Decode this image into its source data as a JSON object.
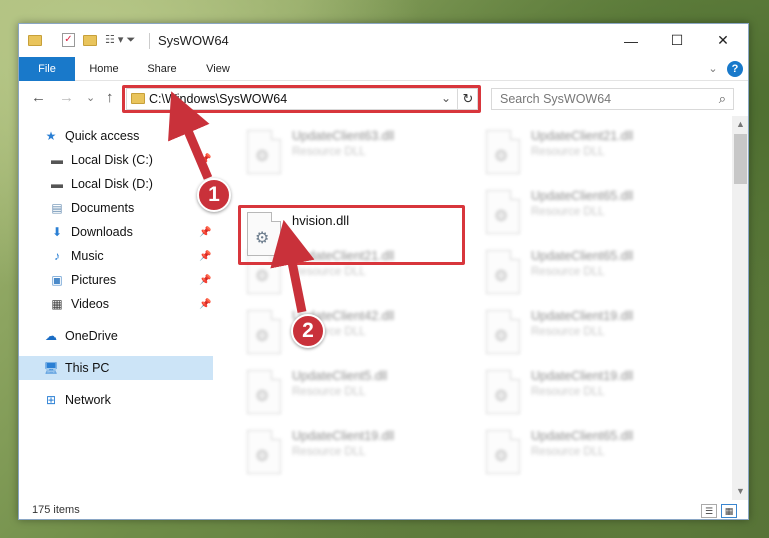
{
  "window": {
    "title": "SysWOW64",
    "minimize_glyph": "—",
    "maximize_glyph": "☐",
    "close_glyph": "✕"
  },
  "ribbon": {
    "tabs": [
      "File",
      "Home",
      "Share",
      "View"
    ],
    "expand_glyph": "⌄",
    "help_glyph": "?"
  },
  "nav": {
    "back": "←",
    "forward": "→",
    "recent": "⌄",
    "up": "↑"
  },
  "address": {
    "path": "C:\\Windows\\SysWOW64",
    "dropdown": "⌄",
    "refresh": "↻"
  },
  "search": {
    "placeholder": "Search SysWOW64",
    "icon": "search-icon"
  },
  "sidebar": {
    "items": [
      {
        "label": "Quick access",
        "icon": "star-icon"
      },
      {
        "label": "Local Disk (C:)",
        "icon": "drive-icon"
      },
      {
        "label": "Local Disk (D:)",
        "icon": "drive-icon"
      },
      {
        "label": "Documents",
        "icon": "documents-icon"
      },
      {
        "label": "Downloads",
        "icon": "downloads-icon"
      },
      {
        "label": "Music",
        "icon": "music-icon"
      },
      {
        "label": "Pictures",
        "icon": "pictures-icon"
      },
      {
        "label": "Videos",
        "icon": "videos-icon"
      },
      {
        "label": "OneDrive",
        "icon": "cloud-icon"
      },
      {
        "label": "This PC",
        "icon": "computer-icon"
      },
      {
        "label": "Network",
        "icon": "network-icon"
      }
    ]
  },
  "files": {
    "highlighted": {
      "name": "hvision.dll"
    },
    "left": [
      {
        "name": "UpdateClient63.dll",
        "type": "Resource DLL"
      },
      {
        "name": "UpdateClient21.dll",
        "type": "Resource DLL"
      },
      {
        "name": "UpdateClient42.dll",
        "type": "Resource DLL"
      },
      {
        "name": "UpdateClient5.dll",
        "type": "Resource DLL"
      },
      {
        "name": "UpdateClient19.dll",
        "type": "Resource DLL"
      }
    ],
    "right": [
      {
        "name": "UpdateClient21.dll",
        "type": "Resource DLL"
      },
      {
        "name": "UpdateClient65.dll",
        "type": "Resource DLL"
      },
      {
        "name": "UpdateClient65.dll",
        "type": "Resource DLL"
      },
      {
        "name": "UpdateClient19.dll",
        "type": "Resource DLL"
      },
      {
        "name": "UpdateClient19.dll",
        "type": "Resource DLL"
      },
      {
        "name": "UpdateClient65.dll",
        "type": "Resource DLL"
      }
    ]
  },
  "status": {
    "count": "175 items"
  },
  "annotations": {
    "step1": "1",
    "step2": "2",
    "color": "#d8363c"
  }
}
